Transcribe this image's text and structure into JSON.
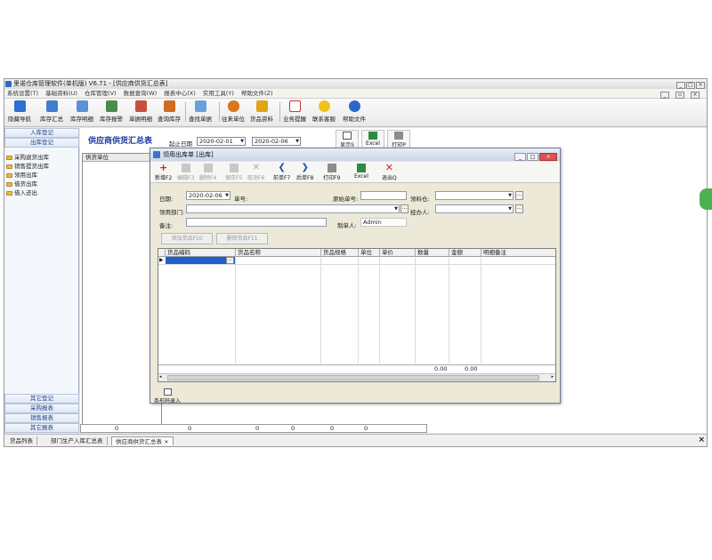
{
  "app": {
    "title": "里诺仓库管理软件(单机版) V6.71 - [供应商供货汇总表]",
    "menu": [
      "系统设置(T)",
      "基础资料(U)",
      "仓库管理(V)",
      "数据查询(W)",
      "报表中心(X)",
      "实用工具(Y)",
      "帮助文件(Z)"
    ],
    "toolbar": [
      "隐藏导航",
      "库存汇总",
      "库存明细",
      "库存报警",
      "单据明细",
      "查询库存",
      "查找单据",
      "往来单位",
      "货品资料",
      "业务提醒",
      "联系客服",
      "帮助文件"
    ]
  },
  "sidebar": {
    "top_buttons": [
      "入库登记",
      "出库登记"
    ],
    "tree": [
      "采购退货出库",
      "销售提货出库",
      "领用出库",
      "借货出库",
      "借入还出"
    ],
    "bottom_buttons": [
      "其它登记",
      "采购报表",
      "销售报表",
      "其它报表"
    ]
  },
  "main": {
    "title": "供应商供货汇总表",
    "date_label": "起止日期",
    "start_date": "2020-02-01",
    "end_date": "2020-02-06",
    "buttons": [
      "显示S",
      "Excel",
      "打印P"
    ],
    "grid_header": "供货单位",
    "totals": [
      "0",
      "0",
      "0",
      "0",
      "0",
      "0"
    ]
  },
  "tabs": [
    "货品列表",
    "部门生产入库汇总表",
    "供应商供货汇总表"
  ],
  "dialog": {
    "title": "领用出库单 [出库]",
    "toolbar": [
      "新增F2",
      "编辑F3",
      "删除F4",
      "保存F5",
      "取消F6",
      "前单F7",
      "后单F8",
      "打印F9",
      "Excel",
      "退出Q"
    ],
    "labels": {
      "date": "日期:",
      "bill_no": "单号:",
      "orig_bill_no": "原始单号:",
      "warehouse": "领料仓:",
      "dept": "领用部门:",
      "handler": "经办人:",
      "remark": "备注:",
      "creator": "制单人:"
    },
    "values": {
      "date": "2020-02-06",
      "creator": "Admin"
    },
    "buttons": [
      "添加货品F10",
      "删除货品F11"
    ],
    "grid_columns": [
      "货品编码",
      "货品名称",
      "货品规格",
      "单位",
      "单价",
      "数量",
      "金额",
      "明细备注"
    ],
    "cell_ellipsis": "...",
    "totals": {
      "qty": "0.00",
      "amount": "0.00"
    },
    "scan_label": "条形码录入"
  }
}
